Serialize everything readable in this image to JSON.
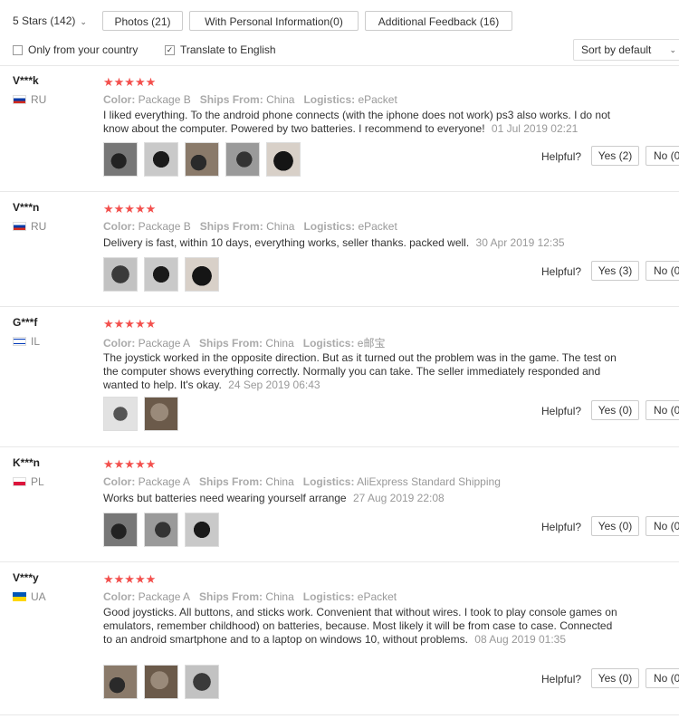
{
  "toolbar": {
    "rating_filter": "5 Stars (142)",
    "photos_button": "Photos (21)",
    "personal_info_button": "With Personal Information(0)",
    "additional_feedback_button": "Additional Feedback (16)",
    "only_country_label": "Only from your country",
    "only_country_checked": false,
    "translate_label": "Translate to English",
    "translate_checked": true,
    "sort_value": "Sort by default"
  },
  "labels": {
    "stars": "★★★★★",
    "color": "Color:",
    "ships_from": "Ships From:",
    "logistics": "Logistics:",
    "helpful": "Helpful?"
  },
  "reviews": [
    {
      "user": "V***k",
      "country": "RU",
      "flag": "ru",
      "color": "Package B",
      "ships_from": "China",
      "logistics": "ePacket",
      "text": "I liked everything. To the android phone connects (with the iphone does not work) ps3 also works. I do not know about the computer. Powered by two batteries. I recommend to everyone!",
      "date": "01 Jul 2019 02:21",
      "yes": "Yes (2)",
      "no": "No (0",
      "photos": 5
    },
    {
      "user": "V***n",
      "country": "RU",
      "flag": "ru",
      "color": "Package B",
      "ships_from": "China",
      "logistics": "ePacket",
      "text": "Delivery is fast, within 10 days, everything works, seller thanks. packed well.",
      "date": "30 Apr 2019 12:35",
      "yes": "Yes (3)",
      "no": "No (0",
      "photos": 3
    },
    {
      "user": "G***f",
      "country": "IL",
      "flag": "il",
      "color": "Package A",
      "ships_from": "China",
      "logistics": "e邮宝",
      "text": "The joystick worked in the opposite direction. But as it turned out the problem was in the game. The test on the computer shows everything correctly. Normally you can take. The seller immediately responded and wanted to help. It's okay.",
      "date": "24 Sep 2019 06:43",
      "yes": "Yes (0)",
      "no": "No (0",
      "photos": 2
    },
    {
      "user": "K***n",
      "country": "PL",
      "flag": "pl",
      "color": "Package A",
      "ships_from": "China",
      "logistics": "AliExpress Standard Shipping",
      "text": "Works but batteries need wearing yourself arrange",
      "date": "27 Aug 2019 22:08",
      "yes": "Yes (0)",
      "no": "No (0",
      "photos": 3
    },
    {
      "user": "V***y",
      "country": "UA",
      "flag": "ua",
      "color": "Package A",
      "ships_from": "China",
      "logistics": "ePacket",
      "text": "Good joysticks. All buttons, and sticks work. Convenient that without wires. I took to play console games on emulators, remember childhood) on batteries, because. Most likely it will be from case to case. Connected to an android smartphone and to a laptop on windows 10, without problems.",
      "date": "08 Aug 2019 01:35",
      "yes": "Yes (0)",
      "no": "No (0",
      "photos": 3
    }
  ]
}
